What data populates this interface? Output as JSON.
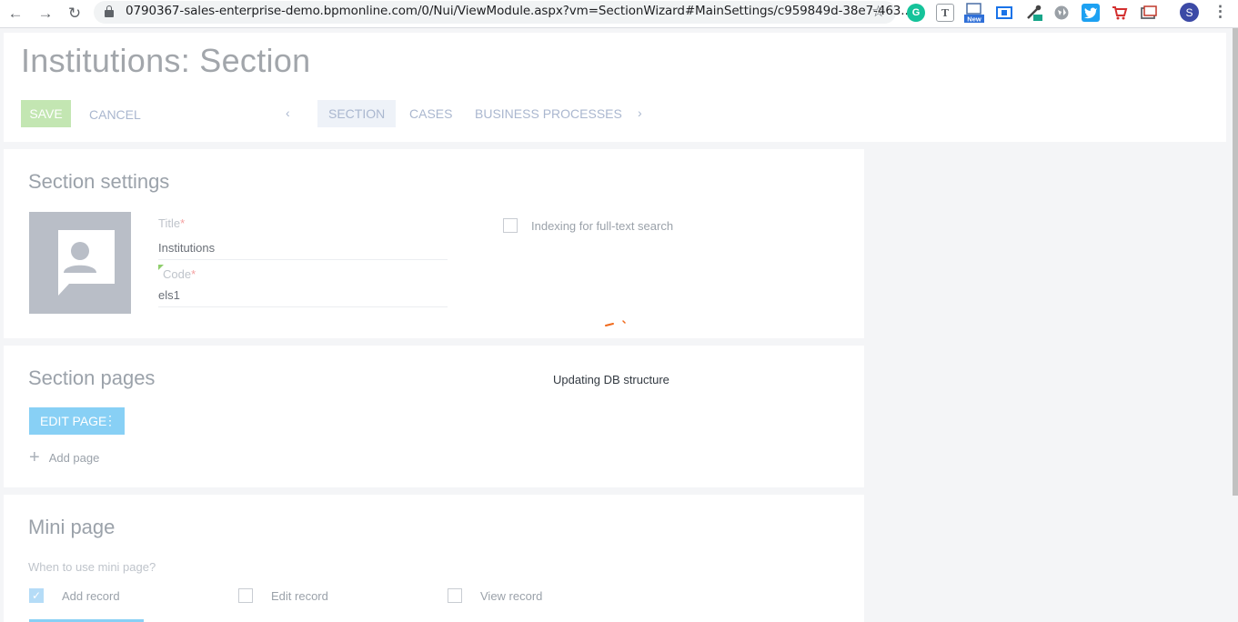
{
  "browser": {
    "url": "0790367-sales-enterprise-demo.bpmonline.com/0/Nui/ViewModule.aspx?vm=SectionWizard#MainSettings/c959849d-38e7-463...",
    "profile_initial": "S",
    "extension_badge": "New"
  },
  "header": {
    "title": "Institutions: Section",
    "save_label": "SAVE",
    "cancel_label": "CANCEL",
    "tabs": [
      {
        "label": "SECTION"
      },
      {
        "label": "CASES"
      },
      {
        "label": "BUSINESS PROCESSES"
      }
    ]
  },
  "section_settings": {
    "title": "Section settings",
    "title_label": "Title",
    "title_value": "Institutions",
    "code_label": "Code",
    "code_value": "els1",
    "required_mark": "*",
    "indexing_label": "Indexing for full-text search",
    "indexing_checked": false
  },
  "section_pages": {
    "title": "Section pages",
    "edit_page_label": "EDIT PAGE",
    "add_page_label": "Add page",
    "status": "Updating DB structure"
  },
  "mini_page": {
    "title": "Mini page",
    "question": "When to use mini page?",
    "options": [
      {
        "label": "Add record",
        "checked": true
      },
      {
        "label": "Edit record",
        "checked": false
      },
      {
        "label": "View record",
        "checked": false
      }
    ]
  },
  "colors": {
    "save_button": "#c3e6b2",
    "edit_page_button": "#88d0f5",
    "accent_text": "#aab7cf",
    "spinner": "#f06a1c"
  }
}
